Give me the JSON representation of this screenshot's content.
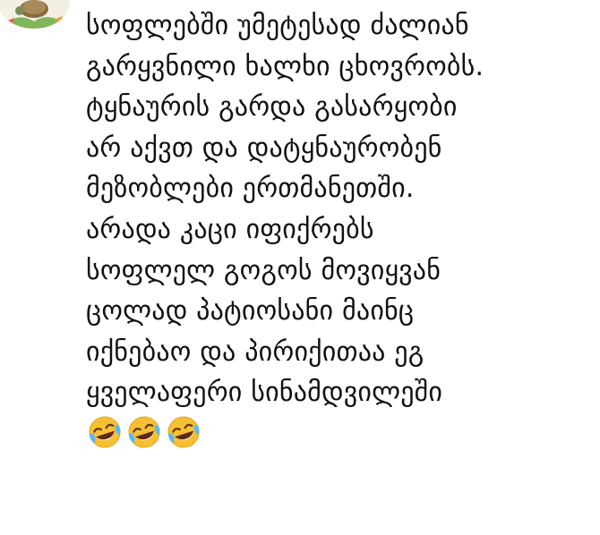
{
  "comment": {
    "avatar_icon": "turtle-avatar-icon",
    "lines": [
      "სოფლებში უმეტესად ძალიან",
      "გარყვნილი ხალხი ცხოვრობს.",
      "ტყნაურის გარდა გასარყობი",
      "არ აქვთ და დატყნაურობენ",
      "მეზობლები ერთმანეთში.",
      "არადა კაცი იფიქრებს",
      "სოფლელ გოგოს მოვიყვან",
      "ცოლად პატიოსანი მაინც",
      "იქნებაო და პირიქითაა ეგ",
      "ყველაფერი სინამდვილეში"
    ],
    "reactions": [
      "face-with-tears-of-joy-icon",
      "face-with-tears-of-joy-icon",
      "face-with-tears-of-joy-icon"
    ]
  },
  "colors": {
    "text": "#111111",
    "background": "#ffffff",
    "emoji_face": "#f7c034",
    "emoji_tears": "#5fb7f2"
  }
}
